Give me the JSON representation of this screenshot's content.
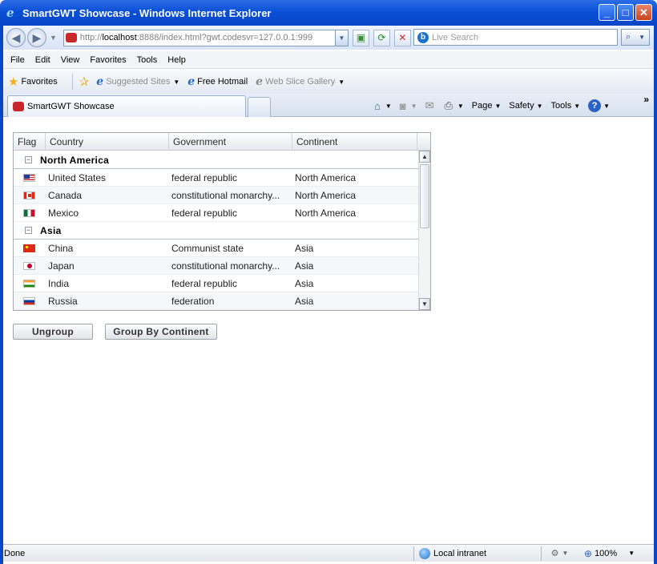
{
  "window": {
    "title": "SmartGWT Showcase - Windows Internet Explorer",
    "minimize": "_",
    "maximize": "□",
    "close": "✕"
  },
  "address_bar": {
    "url_prefix": "http://",
    "url_host": "localhost",
    "url_rest": ":8888/index.html?gwt.codesvr=127.0.0.1:999",
    "search_placeholder": "Live Search"
  },
  "menu": [
    "File",
    "Edit",
    "View",
    "Favorites",
    "Tools",
    "Help"
  ],
  "favorites_bar": {
    "favorites_label": "Favorites",
    "items": [
      {
        "label": "Suggested Sites"
      },
      {
        "label": "Free Hotmail"
      },
      {
        "label": "Web Slice Gallery"
      }
    ]
  },
  "tab": {
    "label": "SmartGWT Showcase"
  },
  "command_bar": {
    "page": "Page",
    "safety": "Safety",
    "tools": "Tools"
  },
  "grid": {
    "columns": [
      "Flag",
      "Country",
      "Government",
      "Continent"
    ],
    "groups": [
      {
        "name": "North America",
        "rows": [
          {
            "flag": "us",
            "country": "United States",
            "government": "federal republic",
            "continent": "North America"
          },
          {
            "flag": "ca",
            "country": "Canada",
            "government": "constitutional monarchy...",
            "continent": "North America"
          },
          {
            "flag": "mx",
            "country": "Mexico",
            "government": "federal republic",
            "continent": "North America"
          }
        ]
      },
      {
        "name": "Asia",
        "rows": [
          {
            "flag": "cn",
            "country": "China",
            "government": "Communist state",
            "continent": "Asia"
          },
          {
            "flag": "jp",
            "country": "Japan",
            "government": "constitutional monarchy...",
            "continent": "Asia"
          },
          {
            "flag": "in",
            "country": "India",
            "government": "federal republic",
            "continent": "Asia"
          },
          {
            "flag": "ru",
            "country": "Russia",
            "government": "federation",
            "continent": "Asia"
          }
        ]
      }
    ]
  },
  "buttons": {
    "ungroup": "Ungroup",
    "group_by_continent": "Group By Continent"
  },
  "status_bar": {
    "status": "Done",
    "zone": "Local intranet",
    "zoom": "100%"
  }
}
